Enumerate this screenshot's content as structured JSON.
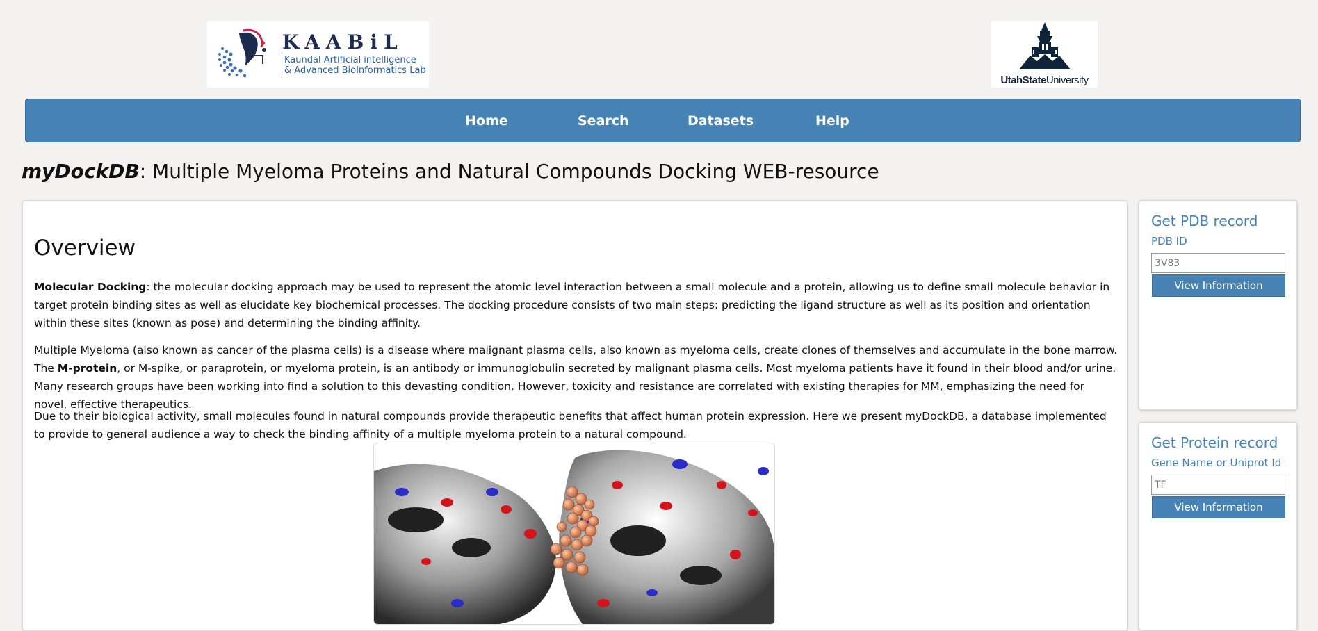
{
  "header": {
    "kaabil_logo": {
      "title": "KAABiL",
      "subtitle_line1": "Kaundal Artificial intelligence",
      "subtitle_line2": "& Advanced BioInformatics Lab"
    },
    "usu_logo": {
      "strong": "UtahState",
      "rest": "University"
    }
  },
  "nav": {
    "items": [
      {
        "label": "Home"
      },
      {
        "label": "Search"
      },
      {
        "label": "Datasets"
      },
      {
        "label": "Help"
      }
    ]
  },
  "page": {
    "title_brand": "myDockDB",
    "title_rest": ": Multiple Myeloma Proteins and Natural Compounds Docking WEB-resource"
  },
  "overview": {
    "heading": "Overview",
    "p1_bold": "Molecular Docking",
    "p1_text": ": the molecular docking approach may be used to represent the atomic level interaction between a small molecule and a protein, allowing us to define small molecule behavior in target protein binding sites as well as elucidate key biochemical processes. The docking procedure consists of two main steps: predicting the ligand structure as well as its position and orientation within these sites (known as pose) and determining the binding affinity.",
    "p2_before": "Multiple Myeloma (also known as cancer of the plasma cells) is a disease where malignant plasma cells, also known as myeloma cells, create clones of themselves and accumulate in the bone marrow. The ",
    "p2_bold": "M-protein",
    "p2_after": ", or M-spike, or paraprotein, or myeloma protein, is an antibody or immunoglobulin secreted by malignant plasma cells. Most myeloma patients have it found in their blood and/or urine. Many research groups have been working into find a solution to this devasting condition. However, toxicity and resistance are correlated with existing therapies for MM, emphasizing the need for novel, effective therapeutics.",
    "p3": "Due to their biological activity, small molecules found in natural compounds provide therapeutic benefits that affect human protein expression. Here we present myDockDB, a database implemented to provide to general audience a way to check the binding affinity of a multiple myeloma protein to a natural compound."
  },
  "pdb_panel": {
    "title": "Get PDB record",
    "label": "PDB ID",
    "placeholder": "3V83",
    "button": "View Information"
  },
  "protein_panel": {
    "title": "Get Protein record",
    "label": "Gene Name or Uniprot Id",
    "placeholder": "TF",
    "button": "View Information"
  }
}
